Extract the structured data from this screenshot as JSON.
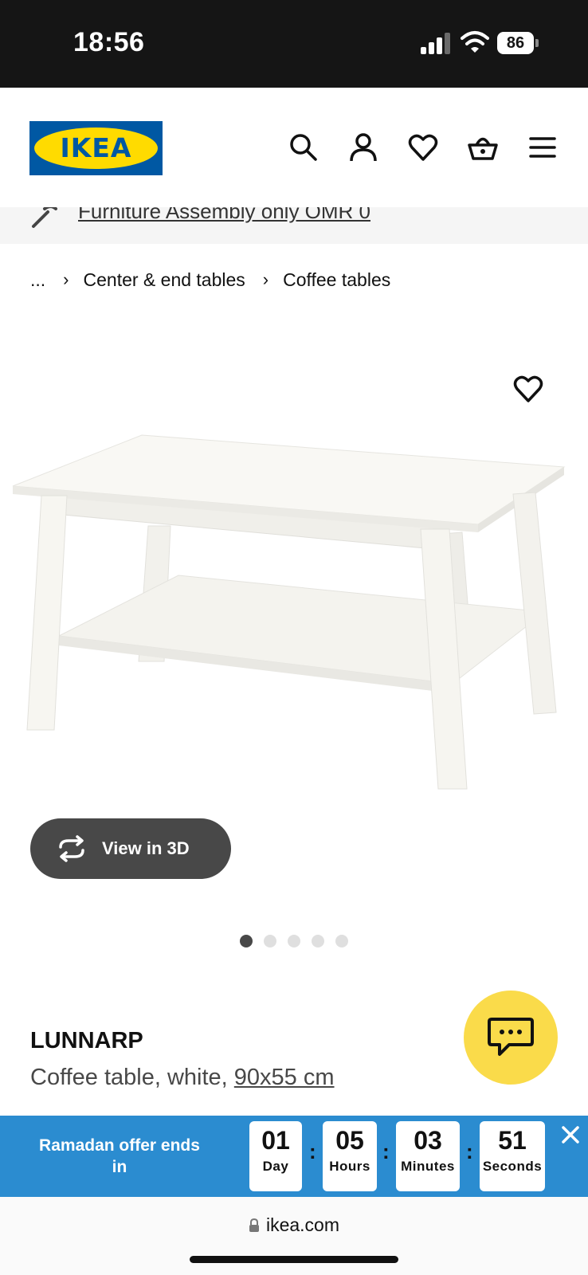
{
  "status_bar": {
    "time": "18:56",
    "battery": "86"
  },
  "header": {
    "logo_text": "IKEA",
    "icons": [
      "search-icon",
      "account-icon",
      "favorites-heart-icon",
      "basket-icon",
      "menu-icon"
    ]
  },
  "promo": {
    "text": "Furniture Assembly only OMR 0"
  },
  "breadcrumb": {
    "ellipsis": "...",
    "items": [
      "Center & end tables",
      "Coffee tables"
    ]
  },
  "gallery": {
    "view3d_label": "View in 3D",
    "total_images": 5,
    "active_index": 0
  },
  "product": {
    "name": "LUNNARP",
    "description": "Coffee table, white, ",
    "size": "90x55 cm"
  },
  "offer": {
    "label": "Ramadan offer ends in",
    "countdown": [
      {
        "value": "01",
        "unit": "Day"
      },
      {
        "value": "05",
        "unit": "Hours"
      },
      {
        "value": "03",
        "unit": "Minutes"
      },
      {
        "value": "51",
        "unit": "Seconds"
      }
    ],
    "close_symbol": "✕"
  },
  "browser": {
    "url": "ikea.com"
  },
  "colors": {
    "brand_blue": "#0058a3",
    "brand_yellow": "#ffdb00",
    "banner_blue": "#2b8cd0",
    "chat_yellow": "#fadb4a"
  }
}
